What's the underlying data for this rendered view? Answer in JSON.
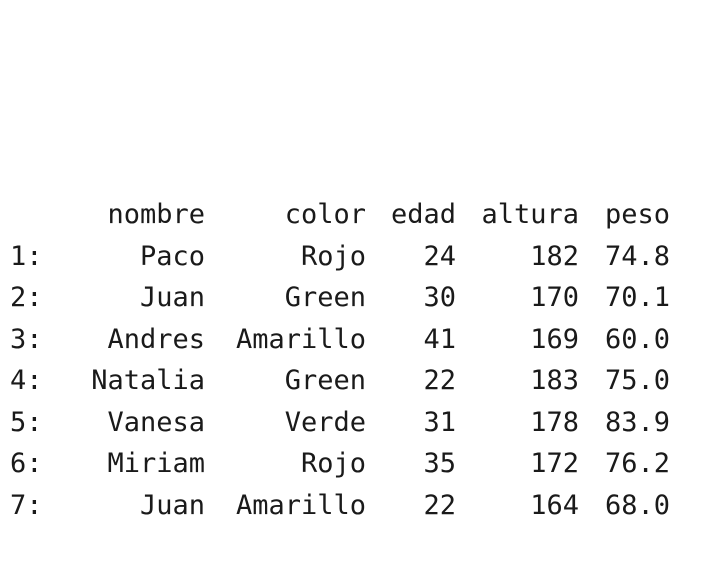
{
  "table": {
    "columns": [
      "nombre",
      "color",
      "edad",
      "altura",
      "peso"
    ],
    "rows": [
      {
        "index": "1:",
        "nombre": "Paco",
        "color": "Rojo",
        "edad": "24",
        "altura": "182",
        "peso": "74.8"
      },
      {
        "index": "2:",
        "nombre": "Juan",
        "color": "Green",
        "edad": "30",
        "altura": "170",
        "peso": "70.1"
      },
      {
        "index": "3:",
        "nombre": "Andres",
        "color": "Amarillo",
        "edad": "41",
        "altura": "169",
        "peso": "60.0"
      },
      {
        "index": "4:",
        "nombre": "Natalia",
        "color": "Green",
        "edad": "22",
        "altura": "183",
        "peso": "75.0"
      },
      {
        "index": "5:",
        "nombre": "Vanesa",
        "color": "Verde",
        "edad": "31",
        "altura": "178",
        "peso": "83.9"
      },
      {
        "index": "6:",
        "nombre": "Miriam",
        "color": "Rojo",
        "edad": "35",
        "altura": "172",
        "peso": "76.2"
      },
      {
        "index": "7:",
        "nombre": "Juan",
        "color": "Amarillo",
        "edad": "22",
        "altura": "164",
        "peso": "68.0"
      }
    ]
  }
}
